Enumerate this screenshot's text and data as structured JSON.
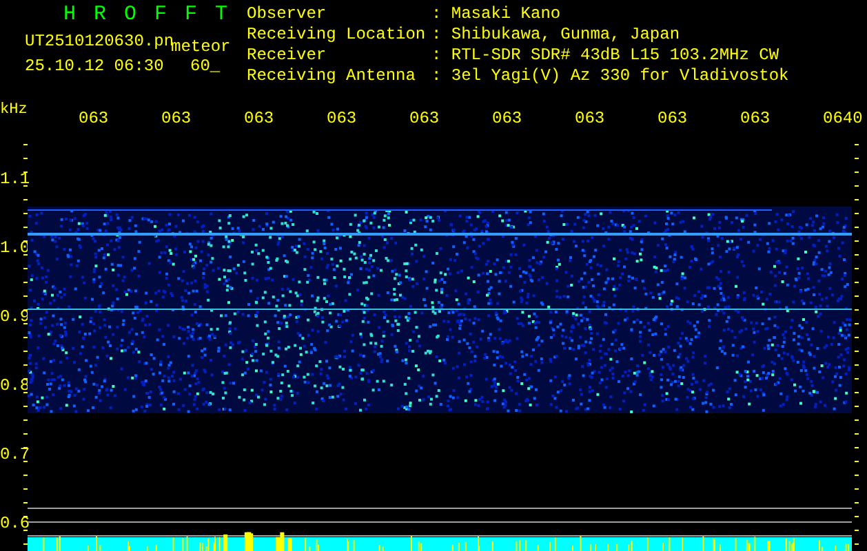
{
  "app_title": "H R O F F T",
  "file_name": "UT2510120630.pn",
  "mode": "meteor",
  "timestamp": "25.10.12 06:30",
  "interval": "60_",
  "station_info": [
    {
      "label": "Observer",
      "value": ": Masaki Kano"
    },
    {
      "label": "Receiving Location",
      "value": ": Shibukawa, Gunma, Japan"
    },
    {
      "label": "Receiver",
      "value": ": RTL-SDR SDR# 43dB L15 103.2MHz CW"
    },
    {
      "label": "Receiving Antenna",
      "value": ": 3el Yagi(V) Az 330 for Vladivostok"
    }
  ],
  "frequency_unit": "kHz",
  "time_labels": [
    "063",
    "063",
    "063",
    "063",
    "063",
    "063",
    "063",
    "063",
    "063",
    "0640"
  ],
  "frequency_labels": [
    "1.1",
    "1.0",
    "0.9",
    "0.8",
    "0.7",
    "0.6"
  ]
}
